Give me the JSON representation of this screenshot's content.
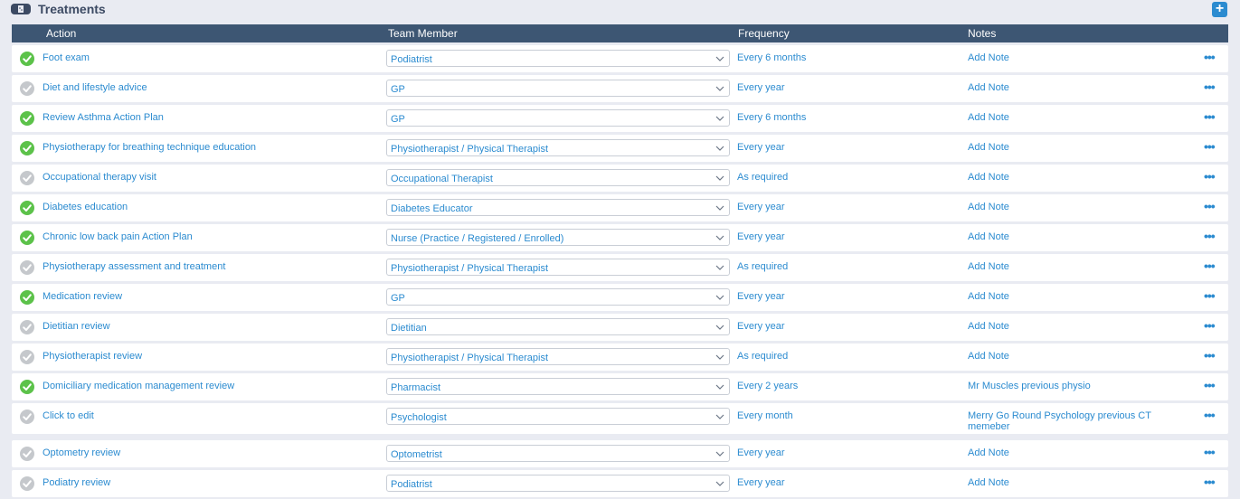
{
  "header": {
    "title": "Treatments",
    "add_label": "+"
  },
  "columns": {
    "action": "Action",
    "team": "Team Member",
    "frequency": "Frequency",
    "notes": "Notes"
  },
  "colors": {
    "done": "#5cc24a",
    "pending": "#c5c8cc",
    "accent": "#2b8bd0",
    "header_bg": "#3d5673"
  },
  "rows": [
    {
      "action": "Foot exam",
      "team": "Podiatrist",
      "frequency": "Every 6 months",
      "notes": "Add Note",
      "done": true
    },
    {
      "action": "Diet and lifestyle advice",
      "team": "GP",
      "frequency": "Every year",
      "notes": "Add Note",
      "done": false
    },
    {
      "action": "Review Asthma Action Plan",
      "team": "GP",
      "frequency": "Every 6 months",
      "notes": "Add Note",
      "done": true
    },
    {
      "action": "Physiotherapy for breathing technique education",
      "team": "Physiotherapist / Physical Therapist",
      "frequency": "Every year",
      "notes": "Add Note",
      "done": true
    },
    {
      "action": "Occupational therapy visit",
      "team": "Occupational Therapist",
      "frequency": "As required",
      "notes": "Add Note",
      "done": false
    },
    {
      "action": "Diabetes education",
      "team": "Diabetes Educator",
      "frequency": "Every year",
      "notes": "Add Note",
      "done": true
    },
    {
      "action": "Chronic low back pain Action Plan",
      "team": "Nurse (Practice / Registered / Enrolled)",
      "frequency": "Every year",
      "notes": "Add Note",
      "done": true
    },
    {
      "action": "Physiotherapy assessment and treatment",
      "team": "Physiotherapist / Physical Therapist",
      "frequency": "As required",
      "notes": "Add Note",
      "done": false
    },
    {
      "action": "Medication review",
      "team": "GP",
      "frequency": "Every year",
      "notes": "Add Note",
      "done": true
    },
    {
      "action": "Dietitian review",
      "team": "Dietitian",
      "frequency": "Every year",
      "notes": "Add Note",
      "done": false
    },
    {
      "action": "Physiotherapist review",
      "team": "Physiotherapist / Physical Therapist",
      "frequency": "As required",
      "notes": "Add Note",
      "done": false
    },
    {
      "action": "Domiciliary medication management review",
      "team": "Pharmacist",
      "frequency": "Every 2 years",
      "notes": "Mr Muscles previous physio",
      "done": true
    },
    {
      "action": "Click to edit",
      "team": "Psychologist",
      "frequency": "Every month",
      "notes": "Merry Go Round Psychology previous CT memeber",
      "done": false
    },
    {
      "action": "Optometry review",
      "team": "Optometrist",
      "frequency": "Every year",
      "notes": "Add Note",
      "done": false
    },
    {
      "action": "Podiatry review",
      "team": "Podiatrist",
      "frequency": "Every year",
      "notes": "Add Note",
      "done": false
    }
  ]
}
